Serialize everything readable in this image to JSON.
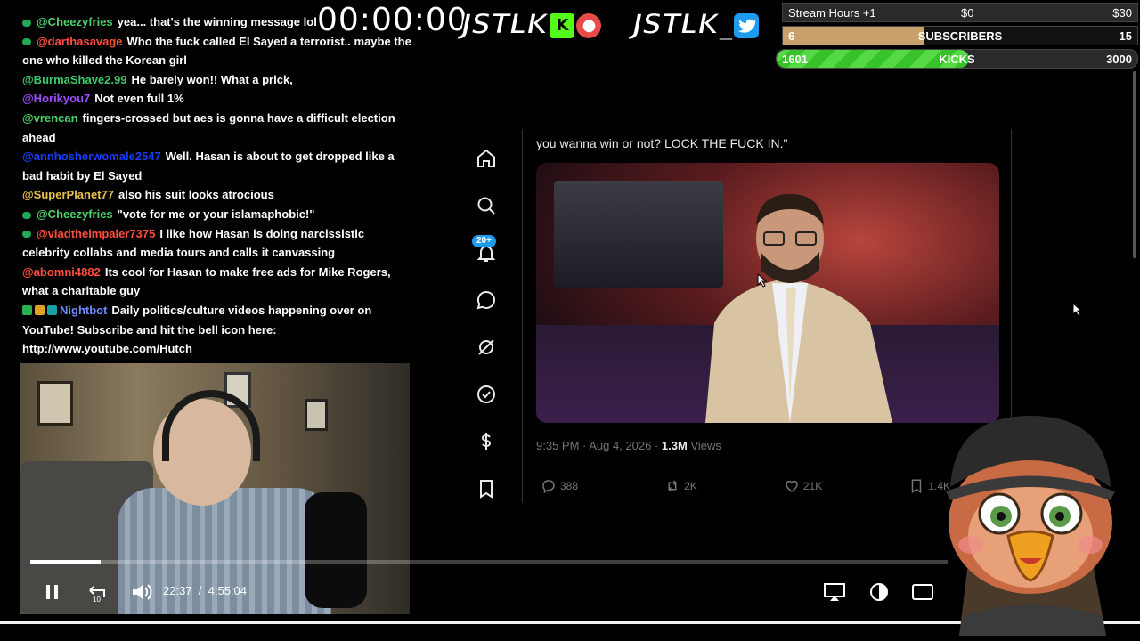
{
  "timer": "00:00:00",
  "logos": {
    "kick_text": "JSTLK",
    "kick_badge": "K",
    "twitter_text": "JSTLK_"
  },
  "goals": [
    {
      "label": "Stream Hours +1",
      "current": "$0",
      "target": "$30",
      "progress": 0,
      "color": "#2a2a2a"
    },
    {
      "label": "SUBSCRIBERS",
      "current": "6",
      "target": "15",
      "progress": 0.4,
      "color": "#c9a06a"
    },
    {
      "label": "KICKS",
      "current": "1601",
      "target": "3000",
      "progress": 0.534,
      "color": "#3ec62e"
    }
  ],
  "chat": [
    {
      "user": "@Cheezyfries",
      "color": "#4fcf6a",
      "badge": "sub",
      "text": "yea... that's the winning message lol"
    },
    {
      "user": "@darthasavage",
      "color": "#ff4d3d",
      "badge": "sub",
      "text": "Who the fuck called El Sayed a terrorist.. maybe the one who killed the Korean girl"
    },
    {
      "user": "@BurmaShave2.99",
      "color": "#3fc96a",
      "badge": "",
      "text": "He barely won!! What a prick,"
    },
    {
      "user": "@Horikyou7",
      "color": "#9b4dff",
      "badge": "",
      "text": "Not even full 1%"
    },
    {
      "user": "@vrencan",
      "color": "#4fcf6a",
      "badge": "",
      "text": "fingers-crossed but aes is gonna have a difficult election ahead"
    },
    {
      "user": "@annhosherwomale2547",
      "color": "#1a3cff",
      "badge": "",
      "text": "Well. Hasan is about to get dropped like a bad habit by El Sayed"
    },
    {
      "user": "@SuperPlanet77",
      "color": "#e8c24a",
      "badge": "",
      "text": "also his suit looks atrocious"
    },
    {
      "user": "@Cheezyfries",
      "color": "#4fcf6a",
      "badge": "sub",
      "text": "\"vote for me or your islamaphobic!\""
    },
    {
      "user": "@vladtheimpaler7375",
      "color": "#ff4d3d",
      "badge": "sub",
      "text": "I like how Hasan is doing narcissistic celebrity collabs and media tours and calls it canvassing"
    },
    {
      "user": "@abomni4882",
      "color": "#ff4d3d",
      "badge": "",
      "text": "Its cool for Hasan to make free ads for Mike Rogers, what a charitable guy"
    },
    {
      "user": "Nightbot",
      "color": "#6e8cff",
      "badge": "bot",
      "text": "Daily politics/culture videos happening over on YouTube! Subscribe and hit the bell icon here: http://www.youtube.com/Hutch"
    }
  ],
  "x_nav": {
    "notif_count": "20+",
    "items": [
      "home-icon",
      "search-icon",
      "bell-icon",
      "chat-icon",
      "grok-icon",
      "verified-icon",
      "money-icon",
      "bookmark-icon"
    ]
  },
  "tweet": {
    "text": "you wanna win or not? LOCK THE FUCK IN.\"",
    "time": "9:35 PM · Aug 4, 2026 · ",
    "views_count": "1.3M",
    "views_label": " Views",
    "replies": "388",
    "reposts": "2K",
    "likes": "21K",
    "bookmarks": "1.4K"
  },
  "player": {
    "current_time": "22:37",
    "separator": "/",
    "duration": "4:55:04",
    "progress": 0.077
  },
  "colors": {
    "twitter_blue": "#1d9bf0",
    "x_border": "#2f3336",
    "x_muted": "#71767b"
  }
}
